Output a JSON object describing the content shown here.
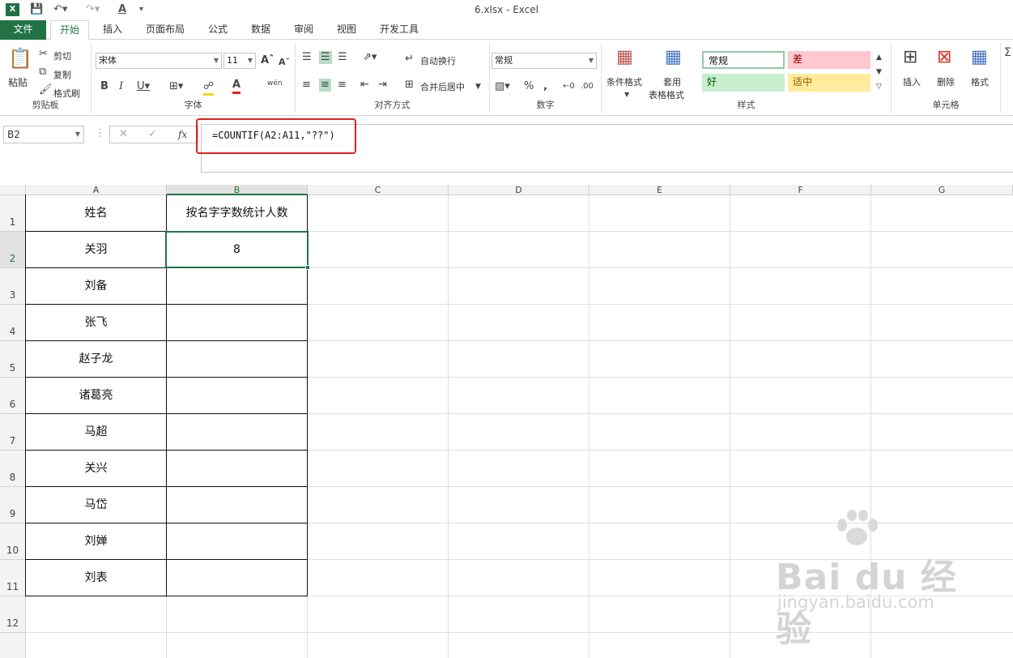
{
  "window": {
    "title": "6.xlsx - Excel"
  },
  "tabs": [
    "文件",
    "开始",
    "插入",
    "页面布局",
    "公式",
    "数据",
    "审阅",
    "视图",
    "开发工具"
  ],
  "ribbon": {
    "clipboard": {
      "paste": "粘贴",
      "cut": "剪切",
      "copy": "复制",
      "format_painter": "格式刷",
      "label": "剪贴板"
    },
    "font": {
      "name": "宋体",
      "size": "11",
      "label": "字体",
      "phonetic": "wén"
    },
    "alignment": {
      "wrap": "自动换行",
      "merge": "合并后居中",
      "label": "对齐方式"
    },
    "number": {
      "format": "常规",
      "label": "数字"
    },
    "styles": {
      "conditional": "条件格式",
      "table_1": "套用",
      "table_2": "表格格式",
      "normal": "常规",
      "bad": "差",
      "good": "好",
      "neutral": "适中",
      "label": "样式"
    },
    "cells": {
      "insert": "插入",
      "delete": "删除",
      "format": "格式",
      "label": "单元格"
    }
  },
  "formula_bar": {
    "name_box": "B2",
    "formula": "=COUNTIF(A2:A11,\"??\")"
  },
  "grid": {
    "columns": [
      "A",
      "B",
      "C",
      "D",
      "E",
      "F",
      "G"
    ],
    "rows": [
      "1",
      "2",
      "3",
      "4",
      "5",
      "6",
      "7",
      "8",
      "9",
      "10",
      "11",
      "12"
    ],
    "header_a": "姓名",
    "header_b": "按名字字数统计人数",
    "names": [
      "关羽",
      "刘备",
      "张飞",
      "赵子龙",
      "诸葛亮",
      "马超",
      "关兴",
      "马岱",
      "刘婵",
      "刘表"
    ],
    "b2_value": "8"
  },
  "watermark": {
    "brand": "Bai du 经验",
    "url": "jingyan.baidu.com"
  }
}
